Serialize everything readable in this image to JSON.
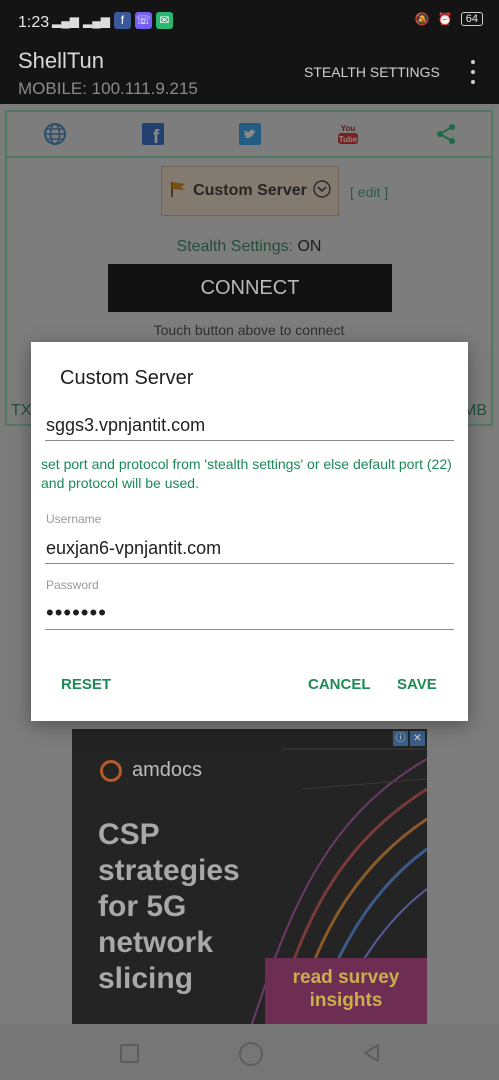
{
  "status_bar": {
    "time": "1:23",
    "signal_text": "\u0002\u0002\u0002",
    "battery": "64"
  },
  "app_bar": {
    "title": "ShellTun",
    "subtitle": "MOBILE: 100.111.9.215",
    "menu_label": "STEALTH SETTINGS"
  },
  "main": {
    "server_label": "Custom Server",
    "edit_label": "[ edit ]",
    "stealth_label": "Stealth Settings:",
    "stealth_value": "ON",
    "connect_label": "CONNECT",
    "touch_hint": "Touch button above to connect",
    "tx_left": "TX",
    "tx_right": "MB"
  },
  "dialog": {
    "title": "Custom Server",
    "host_value": "sggs3.vpnjantit.com",
    "note": "set port and protocol from 'stealth settings' or else default port (22) and protocol will be used.",
    "username_label": "Username",
    "username_value": "euxjan6-vpnjantit.com",
    "password_label": "Password",
    "password_value": "•••••••",
    "reset_label": "RESET",
    "cancel_label": "CANCEL",
    "save_label": "SAVE"
  },
  "ad": {
    "brand": "amdocs",
    "headline": "CSP\nstrategies\nfor 5G\nnetwork\nslicing",
    "cta": "read survey\ninsights"
  },
  "colors": {
    "accent_green": "#1e8a55",
    "dim_overlay": "#7c7c7c"
  },
  "icons": [
    "globe-icon",
    "facebook-icon",
    "twitter-icon",
    "youtube-icon",
    "share-icon",
    "flag-icon",
    "chevron-down-icon"
  ]
}
